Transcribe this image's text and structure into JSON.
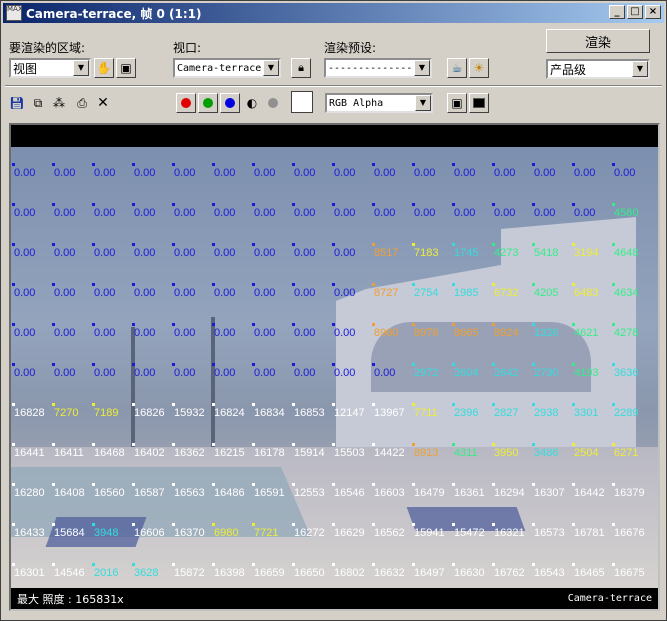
{
  "window": {
    "title": "Camera-terrace, 帧 0 (1:1)",
    "icon_text": "MAX",
    "controls": [
      "_",
      "□",
      "×"
    ]
  },
  "toolbar": {
    "area_label": "要渲染的区域:",
    "area_value": "视图",
    "viewport_label": "视口:",
    "viewport_value": "Camera-terrace",
    "preset_label": "渲染预设:",
    "preset_value": "--------------------",
    "render_button": "渲染",
    "quality_value": "产品级",
    "channel_value": "RGB Alpha"
  },
  "colors": {
    "red_channel": "#e00000",
    "green_channel": "#00a000",
    "blue_channel": "#0000e0",
    "title_start": "#0a246a",
    "title_end": "#a6caf0"
  },
  "status": {
    "left": "最大 照度 : 165831x",
    "right": "Camera-terrace"
  },
  "grid": {
    "rows": [
      [
        "0.00",
        "0.00",
        "0.00",
        "0.00",
        "0.00",
        "0.00",
        "0.00",
        "0.00",
        "0.00",
        "0.00",
        "0.00",
        "0.00",
        "0.00",
        "0.00",
        "0.00",
        "0.00"
      ],
      [
        "0.00",
        "0.00",
        "0.00",
        "0.00",
        "0.00",
        "0.00",
        "0.00",
        "0.00",
        "0.00",
        "0.00",
        "0.00",
        "0.00",
        "0.00",
        "0.00",
        "0.00",
        "4580"
      ],
      [
        "0.00",
        "0.00",
        "0.00",
        "0.00",
        "0.00",
        "0.00",
        "0.00",
        "0.00",
        "0.00",
        "8517",
        "7183",
        "1745",
        "4273",
        "5418",
        "3194",
        "4648"
      ],
      [
        "0.00",
        "0.00",
        "0.00",
        "0.00",
        "0.00",
        "0.00",
        "0.00",
        "0.00",
        "0.00",
        "8727",
        "2754",
        "1985",
        "6732",
        "4205",
        "6483",
        "4634"
      ],
      [
        "0.00",
        "0.00",
        "0.00",
        "0.00",
        "0.00",
        "0.00",
        "0.00",
        "0.00",
        "0.00",
        "8960",
        "8976",
        "8665",
        "8924",
        "1326",
        "4621",
        "4278"
      ],
      [
        "0.00",
        "0.00",
        "0.00",
        "0.00",
        "0.00",
        "0.00",
        "0.00",
        "0.00",
        "0.00",
        "0.00",
        "2972",
        "2604",
        "2642",
        "2730",
        "4193",
        "3636"
      ],
      [
        "16828",
        "7270",
        "7189",
        "16826",
        "15932",
        "16824",
        "16834",
        "16853",
        "12147",
        "13967",
        "7711",
        "2396",
        "2827",
        "2938",
        "3301",
        "2289"
      ],
      [
        "16441",
        "16411",
        "16468",
        "16402",
        "16362",
        "16215",
        "16178",
        "15914",
        "15503",
        "14422",
        "8913",
        "4311",
        "3950",
        "3486",
        "2504",
        "6271"
      ],
      [
        "16280",
        "16408",
        "16560",
        "16587",
        "16563",
        "16486",
        "16591",
        "12553",
        "16546",
        "16603",
        "16479",
        "16361",
        "16294",
        "16307",
        "16442",
        "16379"
      ],
      [
        "16433",
        "15684",
        "3948",
        "16606",
        "16370",
        "6980",
        "7721",
        "16272",
        "16629",
        "16562",
        "15941",
        "15472",
        "16321",
        "16573",
        "16781",
        "16676"
      ],
      [
        "16301",
        "14546",
        "2016",
        "3628",
        "15872",
        "16398",
        "16659",
        "16650",
        "16802",
        "16632",
        "16497",
        "16630",
        "16762",
        "16543",
        "16465",
        "16675"
      ]
    ],
    "colors": [
      [
        "b",
        "b",
        "b",
        "b",
        "b",
        "b",
        "b",
        "b",
        "b",
        "b",
        "b",
        "b",
        "b",
        "b",
        "b",
        "b"
      ],
      [
        "b",
        "b",
        "b",
        "b",
        "b",
        "b",
        "b",
        "b",
        "b",
        "b",
        "b",
        "b",
        "b",
        "b",
        "b",
        "g"
      ],
      [
        "b",
        "b",
        "b",
        "b",
        "b",
        "b",
        "b",
        "b",
        "b",
        "o",
        "y",
        "c",
        "g",
        "g",
        "y",
        "g"
      ],
      [
        "b",
        "b",
        "b",
        "b",
        "b",
        "b",
        "b",
        "b",
        "b",
        "o",
        "c",
        "c",
        "y",
        "g",
        "y",
        "g"
      ],
      [
        "b",
        "b",
        "b",
        "b",
        "b",
        "b",
        "b",
        "b",
        "b",
        "o",
        "o",
        "o",
        "o",
        "c",
        "g",
        "g"
      ],
      [
        "b",
        "b",
        "b",
        "b",
        "b",
        "b",
        "b",
        "b",
        "b",
        "b",
        "c",
        "c",
        "c",
        "c",
        "g",
        "c"
      ],
      [
        "w",
        "y",
        "y",
        "w",
        "w",
        "w",
        "w",
        "w",
        "w",
        "w",
        "y",
        "c",
        "c",
        "c",
        "c",
        "c"
      ],
      [
        "w",
        "w",
        "w",
        "w",
        "w",
        "w",
        "w",
        "w",
        "w",
        "w",
        "o",
        "g",
        "y",
        "c",
        "y",
        "y"
      ],
      [
        "w",
        "w",
        "w",
        "w",
        "w",
        "w",
        "w",
        "w",
        "w",
        "w",
        "w",
        "w",
        "w",
        "w",
        "w",
        "w"
      ],
      [
        "w",
        "w",
        "c",
        "w",
        "w",
        "y",
        "y",
        "w",
        "w",
        "w",
        "w",
        "w",
        "w",
        "w",
        "w",
        "w"
      ],
      [
        "w",
        "w",
        "c",
        "c",
        "w",
        "w",
        "w",
        "w",
        "w",
        "w",
        "w",
        "w",
        "w",
        "w",
        "w",
        "w"
      ]
    ],
    "palette": {
      "b": "#1a1ad8",
      "g": "#33ee88",
      "c": "#33dddd",
      "y": "#eeee33",
      "o": "#f0a030",
      "w": "#ffffff"
    }
  }
}
